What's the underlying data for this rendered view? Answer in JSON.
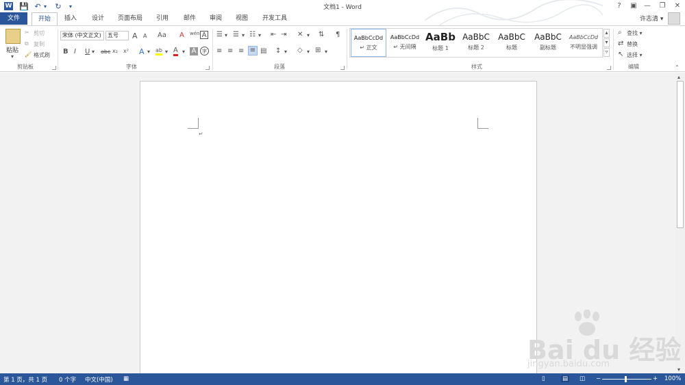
{
  "window": {
    "title": "文档1 - Word",
    "help": "?",
    "ribbon_display": "▣",
    "minimize": "—",
    "restore": "❐",
    "close": "✕"
  },
  "qat": {
    "save": "💾",
    "undo": "↶",
    "redo": "↻",
    "customize": "▾"
  },
  "tabs": [
    "开始",
    "插入",
    "设计",
    "页面布局",
    "引用",
    "邮件",
    "审阅",
    "视图",
    "开发工具"
  ],
  "file_tab": "文件",
  "user": {
    "name": "许志清 ▾"
  },
  "clipboard": {
    "paste": "粘贴",
    "cut": "剪切",
    "copy": "复制",
    "format_painter": "格式刷",
    "label": "剪贴板"
  },
  "font": {
    "name": "宋体 (中文正文)",
    "size": "五号",
    "grow": "A",
    "shrink": "A",
    "case": "Aa",
    "clear": "A",
    "phonetic": "wén",
    "border_char": "A",
    "bold": "B",
    "italic": "I",
    "underline": "U",
    "strike": "abc",
    "sub": "x₂",
    "sup": "x²",
    "effects": "A",
    "highlight": "ab",
    "color": "A",
    "shading": "A",
    "enclose": "字",
    "label": "字体"
  },
  "paragraph": {
    "label": "段落"
  },
  "styles": {
    "items": [
      {
        "sample": "AaBbCcDd",
        "name": "↵ 正文"
      },
      {
        "sample": "AaBbCcDd",
        "name": "↵ 无间隔"
      },
      {
        "sample": "AaBb",
        "name": "标题 1"
      },
      {
        "sample": "AaBbC",
        "name": "标题 2"
      },
      {
        "sample": "AaBbC",
        "name": "标题"
      },
      {
        "sample": "AaBbC",
        "name": "副标题"
      },
      {
        "sample": "AaBbCcDd",
        "name": "不明显强调"
      }
    ],
    "label": "样式"
  },
  "editing": {
    "find": "查找 ▾",
    "replace": "替换",
    "select": "选择 ▾",
    "label": "编辑"
  },
  "document": {
    "paragraph_mark": "↵"
  },
  "status": {
    "page": "第 1 页，共 1 页",
    "words": "0 个字",
    "language": "中文(中国)",
    "zoom": "100%",
    "zoom_minus": "−",
    "zoom_plus": "+"
  },
  "watermark": {
    "brand": "Bai du 经验",
    "url": "jingyan.baidu.com"
  },
  "colors": {
    "accent": "#2b579a",
    "font_color": "#e02020",
    "highlight": "#ffff00"
  }
}
